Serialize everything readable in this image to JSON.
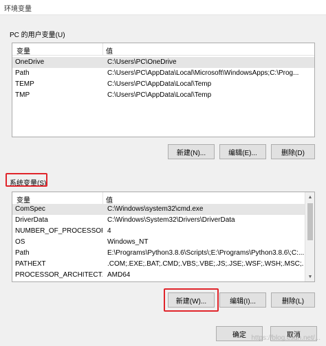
{
  "window": {
    "title": "环境变量"
  },
  "user_vars": {
    "group_label": "PC 的用户变量(U)",
    "columns": [
      "变量",
      "值"
    ],
    "rows": [
      {
        "name": "OneDrive",
        "value": "C:\\Users\\PC\\OneDrive"
      },
      {
        "name": "Path",
        "value": "C:\\Users\\PC\\AppData\\Local\\Microsoft\\WindowsApps;C:\\Prog..."
      },
      {
        "name": "TEMP",
        "value": "C:\\Users\\PC\\AppData\\Local\\Temp"
      },
      {
        "name": "TMP",
        "value": "C:\\Users\\PC\\AppData\\Local\\Temp"
      }
    ],
    "buttons": {
      "new": "新建(N)...",
      "edit": "编辑(E)...",
      "delete": "删除(D)"
    }
  },
  "system_vars": {
    "group_label": "系统变量(S)",
    "columns": [
      "变量",
      "值"
    ],
    "rows": [
      {
        "name": "ComSpec",
        "value": "C:\\Windows\\system32\\cmd.exe"
      },
      {
        "name": "DriverData",
        "value": "C:\\Windows\\System32\\Drivers\\DriverData"
      },
      {
        "name": "NUMBER_OF_PROCESSORS",
        "value": "4"
      },
      {
        "name": "OS",
        "value": "Windows_NT"
      },
      {
        "name": "Path",
        "value": "E:\\Programs\\Python3.8.6\\Scripts\\;E:\\Programs\\Python3.8.6\\;C:..."
      },
      {
        "name": "PATHEXT",
        "value": ".COM;.EXE;.BAT;.CMD;.VBS;.VBE;.JS;.JSE;.WSF;.WSH;.MSC;.PY;.P..."
      },
      {
        "name": "PROCESSOR_ARCHITECT...",
        "value": "AMD64"
      }
    ],
    "buttons": {
      "new": "新建(W)...",
      "edit": "编辑(I)...",
      "delete": "删除(L)"
    }
  },
  "dialog_buttons": {
    "ok": "确定",
    "cancel": "取消"
  },
  "watermark": "https://blog.csdn.net/...",
  "colors": {
    "highlight": "#e0242a",
    "selected_row": "#e5e5e5"
  }
}
